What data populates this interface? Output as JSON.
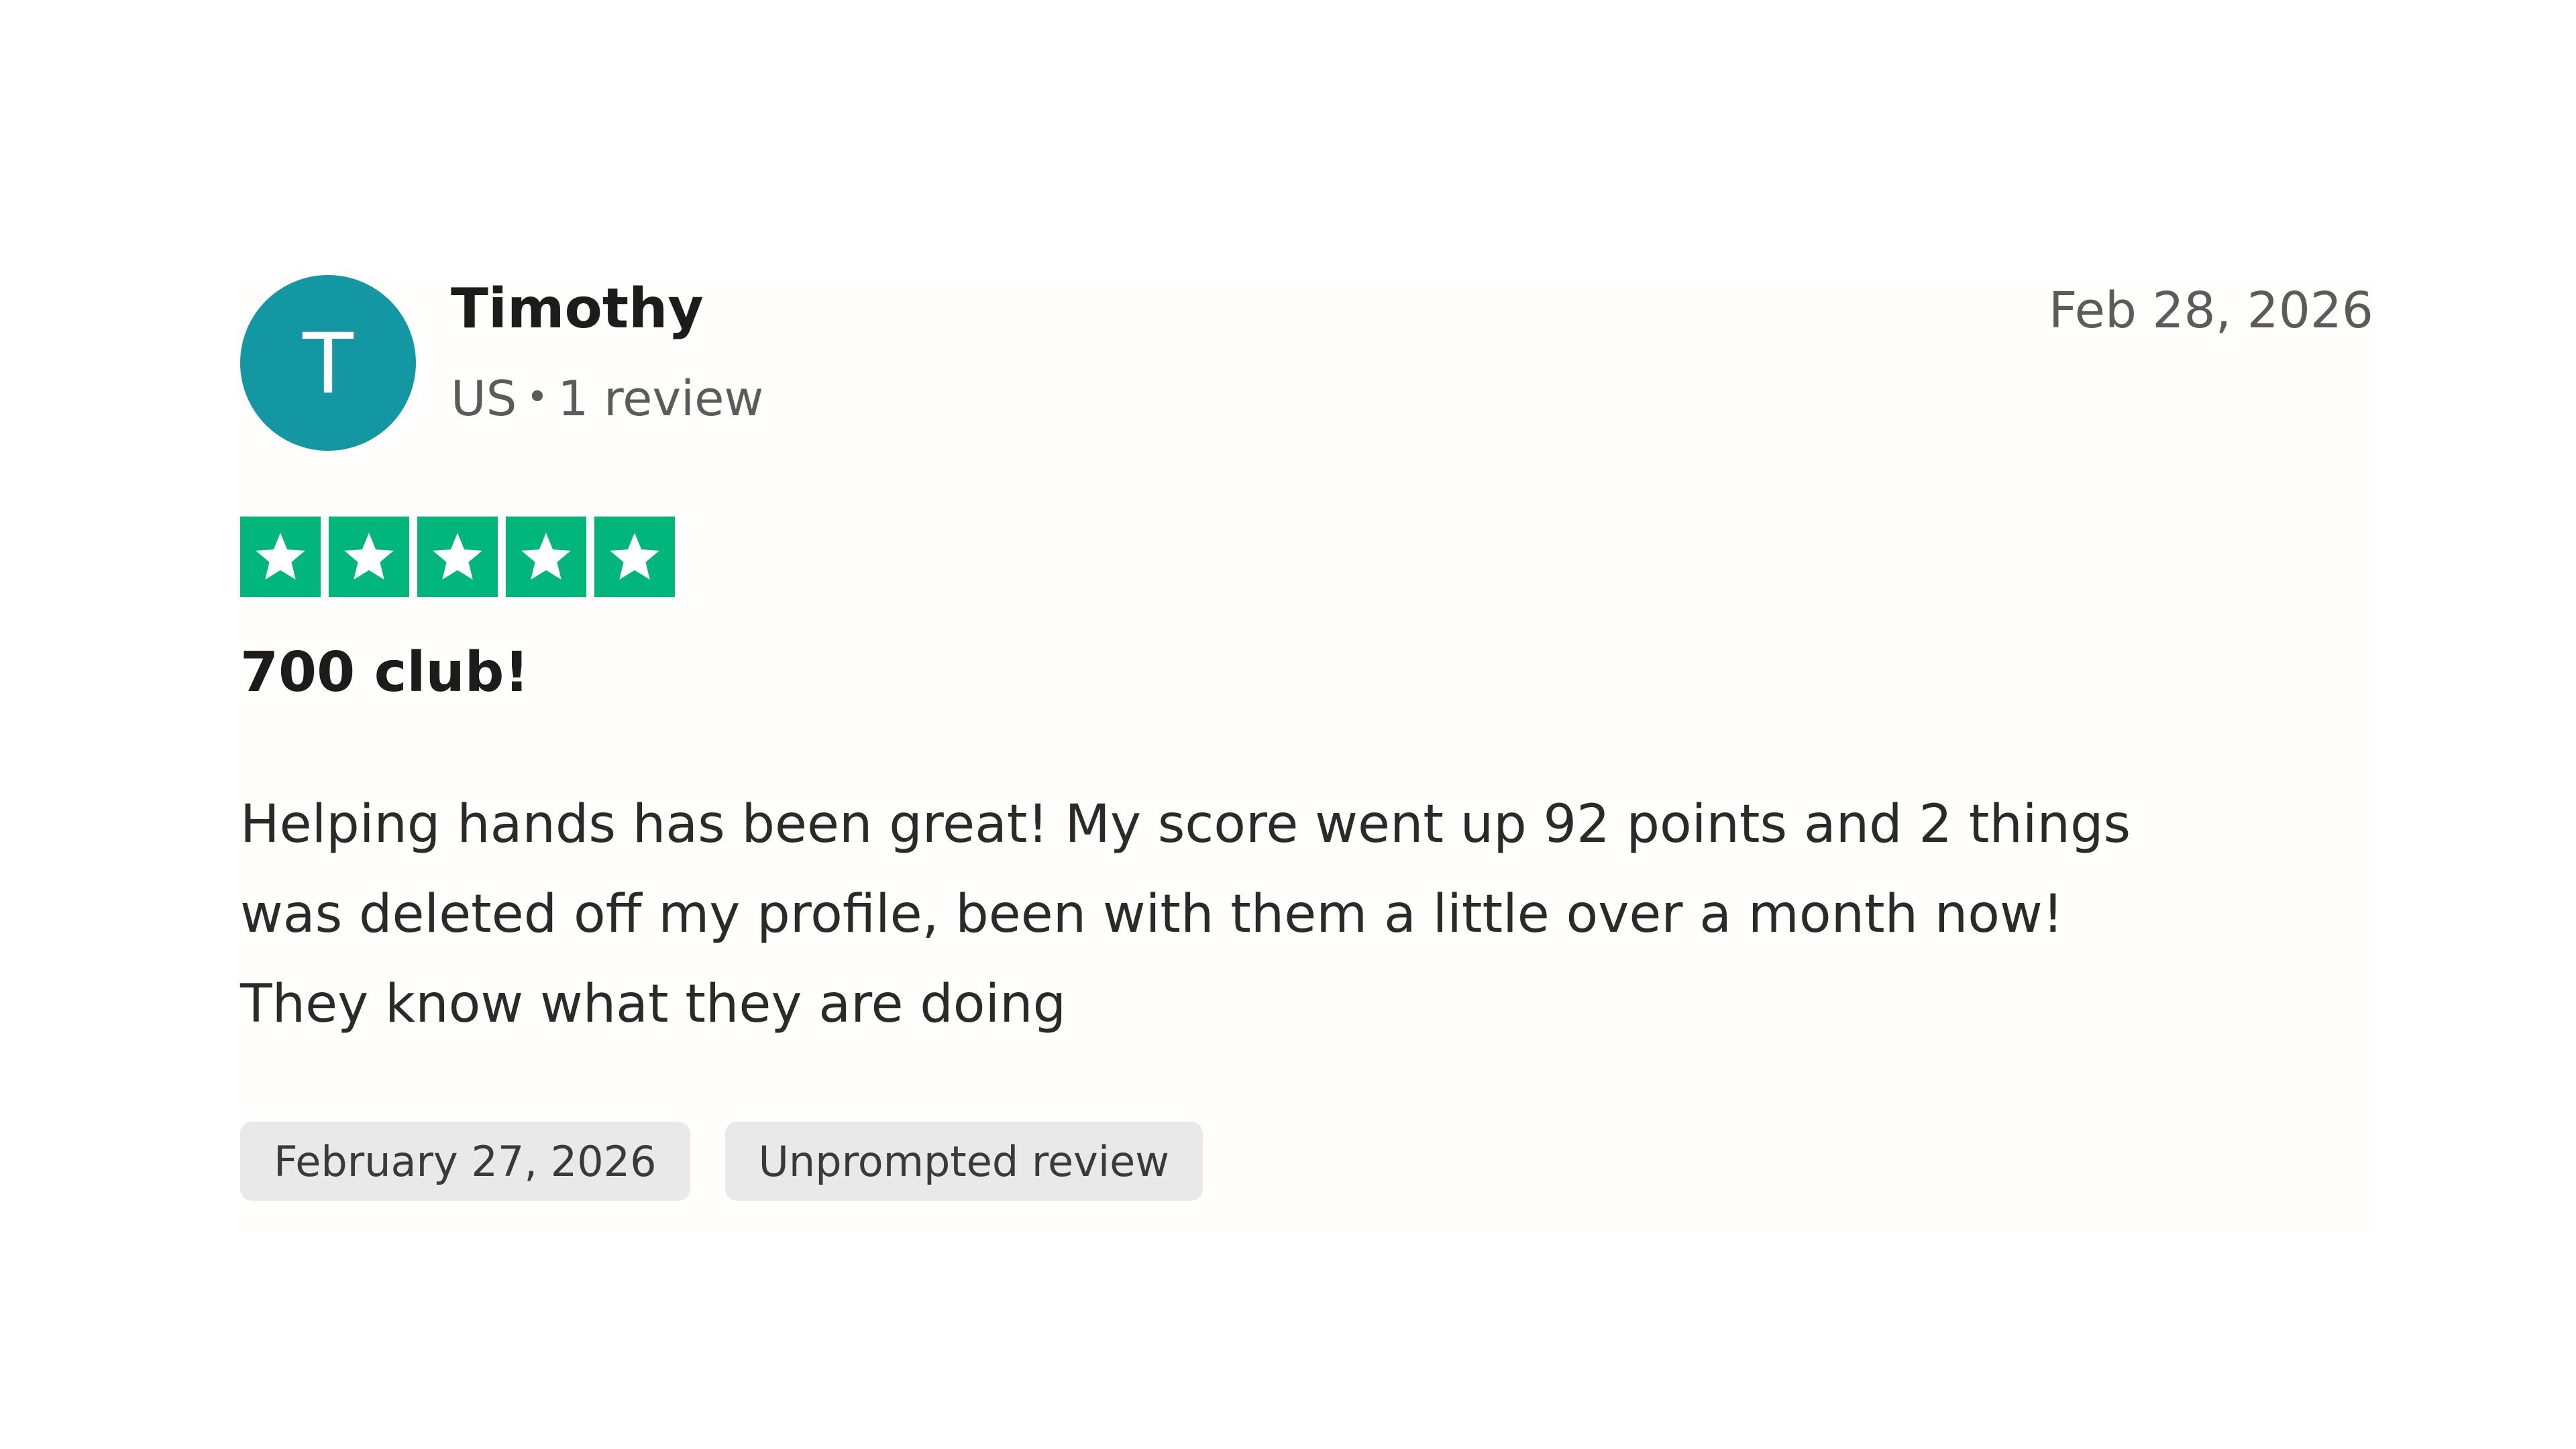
{
  "review": {
    "reviewer": {
      "initial": "T",
      "name": "Timothy",
      "country": "US",
      "dot": "•",
      "review_count": "1 review",
      "avatar_color": "#1397a3"
    },
    "date_top": "Feb 28, 2026",
    "rating": {
      "value": 5,
      "max": 5,
      "star_color": "#00b67a",
      "icon": "star-icon"
    },
    "title": "700 club!",
    "body_lines": [
      "Helping hands has been great! My score went up 92 points and 2 things",
      "was deleted off my profile, been with them a little over a month now!",
      "They know what they are doing"
    ],
    "chips": {
      "date_of_experience": "February 27, 2026",
      "review_type": "Unprompted review"
    }
  }
}
